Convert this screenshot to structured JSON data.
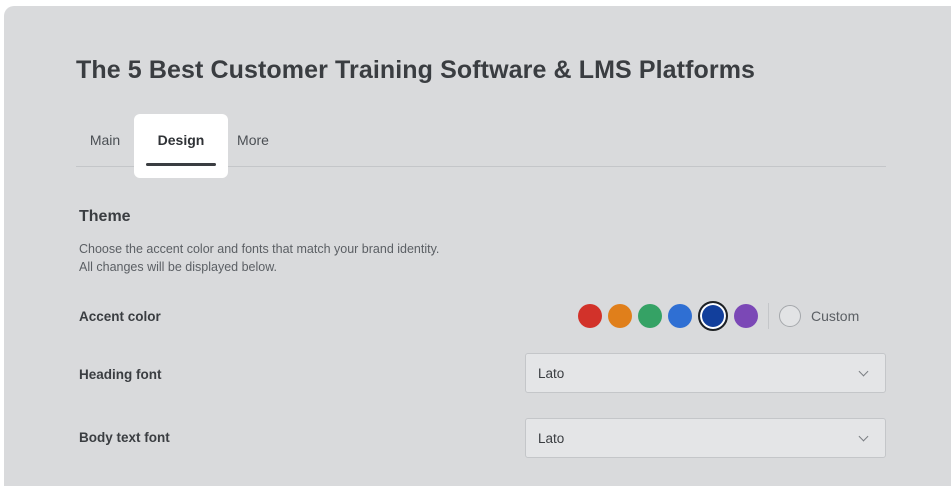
{
  "page": {
    "title": "The 5 Best Customer Training Software & LMS Platforms"
  },
  "tabs": [
    {
      "label": "Main",
      "active": false
    },
    {
      "label": "Design",
      "active": true
    },
    {
      "label": "More",
      "active": false
    }
  ],
  "theme": {
    "heading": "Theme",
    "description_line1": "Choose the accent color and fonts that match your brand identity.",
    "description_line2": "All changes will be displayed below."
  },
  "accent": {
    "label": "Accent color",
    "colors": [
      {
        "name": "red",
        "hex": "#d2322a"
      },
      {
        "name": "orange",
        "hex": "#e07f1b"
      },
      {
        "name": "green",
        "hex": "#35a265"
      },
      {
        "name": "blue",
        "hex": "#2f6fd3"
      },
      {
        "name": "dark-blue",
        "hex": "#123f9c",
        "selected": true
      },
      {
        "name": "purple",
        "hex": "#7b48b6"
      }
    ],
    "custom_label": "Custom"
  },
  "heading_font": {
    "label": "Heading font",
    "value": "Lato"
  },
  "body_font": {
    "label": "Body text font",
    "value": "Lato"
  }
}
